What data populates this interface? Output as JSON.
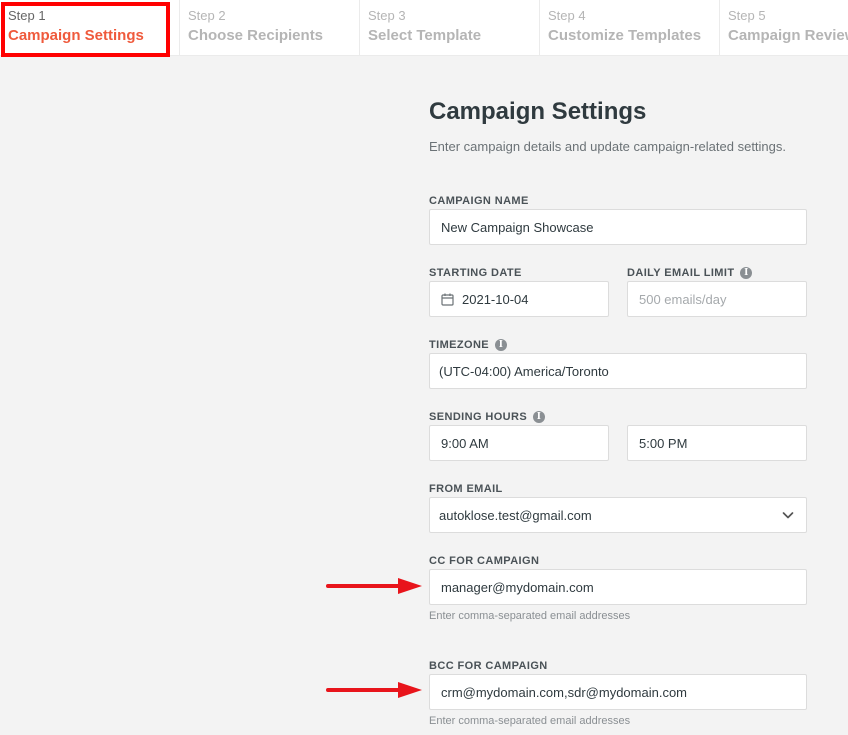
{
  "steps": [
    {
      "num": "Step 1",
      "title": "Campaign Settings"
    },
    {
      "num": "Step 2",
      "title": "Choose Recipients"
    },
    {
      "num": "Step 3",
      "title": "Select Template"
    },
    {
      "num": "Step 4",
      "title": "Customize Templates"
    },
    {
      "num": "Step 5",
      "title": "Campaign Review"
    }
  ],
  "page": {
    "title": "Campaign Settings",
    "subtitle": "Enter campaign details and update campaign-related settings."
  },
  "form": {
    "campaign_name": {
      "label": "CAMPAIGN NAME",
      "value": "New Campaign Showcase"
    },
    "starting_date": {
      "label": "STARTING DATE",
      "value": "2021-10-04",
      "icon": "calendar-icon"
    },
    "daily_limit": {
      "label": "DAILY EMAIL LIMIT",
      "placeholder": "500 emails/day",
      "icon": "info-icon"
    },
    "timezone": {
      "label": "TIMEZONE",
      "value": "(UTC-04:00) America/Toronto",
      "icon": "info-icon"
    },
    "sending_hours": {
      "label": "SENDING HOURS",
      "start": "9:00 AM",
      "end": "5:00 PM",
      "icon": "info-icon"
    },
    "from_email": {
      "label": "FROM EMAIL",
      "value": "autoklose.test@gmail.com",
      "icon": "chevron-down-icon"
    },
    "cc": {
      "label": "CC FOR CAMPAIGN",
      "value": "manager@mydomain.com",
      "hint": "Enter comma-separated email addresses"
    },
    "bcc": {
      "label": "BCC FOR CAMPAIGN",
      "value": "crm@mydomain.com,sdr@mydomain.com",
      "hint": "Enter comma-separated email addresses"
    }
  },
  "colors": {
    "accent": "#ef5a3c",
    "highlight": "#ff0000",
    "annotation_arrow": "#e8141b"
  }
}
